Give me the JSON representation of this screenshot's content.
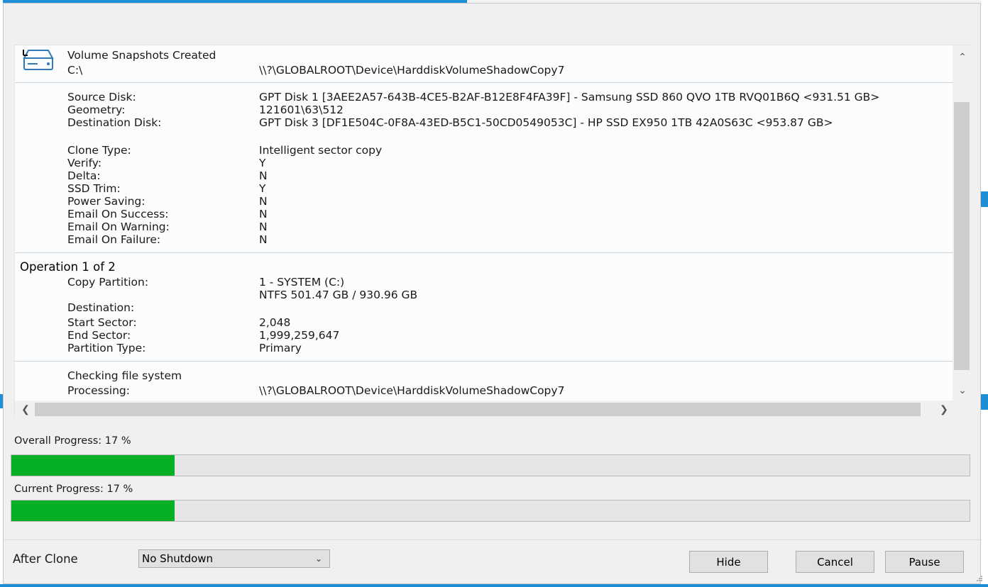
{
  "log": {
    "snapshot_heading": "Volume Snapshots Created",
    "snapshot_drive": "C:\\",
    "snapshot_path": "\\\\?\\GLOBALROOT\\Device\\HarddiskVolumeShadowCopy7",
    "disk_rows": [
      {
        "label": "Source Disk:",
        "value": "GPT Disk 1 [3AEE2A57-643B-4CE5-B2AF-B12E8F4FA39F] - Samsung SSD 860 QVO 1TB RVQ01B6Q  <931.51 GB>"
      },
      {
        "label": "Geometry:",
        "value": "121601\\63\\512"
      },
      {
        "label": "Destination Disk:",
        "value": "GPT Disk 3 [DF1E504C-0F8A-43ED-B5C1-50CD0549053C] - HP SSD EX950 1TB 42A0S63C  <953.87 GB>"
      }
    ],
    "settings_rows": [
      {
        "label": "Clone Type:",
        "value": "Intelligent sector copy"
      },
      {
        "label": "Verify:",
        "value": "Y"
      },
      {
        "label": "Delta:",
        "value": "N"
      },
      {
        "label": "SSD Trim:",
        "value": "Y"
      },
      {
        "label": "Power Saving:",
        "value": "N"
      },
      {
        "label": "Email On Success:",
        "value": "N"
      },
      {
        "label": "Email On Warning:",
        "value": "N"
      },
      {
        "label": "Email On Failure:",
        "value": "N"
      }
    ],
    "operation_heading": "Operation 1 of 2",
    "copy_partition_label": "Copy Partition:",
    "copy_partition_value": "1 - SYSTEM (C:)",
    "copy_partition_detail": "NTFS 501.47 GB / 930.96 GB",
    "destination_label": "Destination:",
    "partition_rows": [
      {
        "label": "Start Sector:",
        "value": "2,048"
      },
      {
        "label": "End Sector:",
        "value": "1,999,259,647"
      },
      {
        "label": "Partition Type:",
        "value": "Primary"
      }
    ],
    "checking_heading": "Checking file system",
    "processing_label": "Processing:",
    "processing_value": "\\\\?\\GLOBALROOT\\Device\\HarddiskVolumeShadowCopy7"
  },
  "progress": {
    "overall_label": "Overall Progress:  17 %",
    "overall_percent": 17,
    "current_label": "Current Progress:  17 %",
    "current_percent": 17
  },
  "after_clone": {
    "label": "After Clone",
    "selected": "No Shutdown"
  },
  "buttons": {
    "hide": "Hide",
    "cancel": "Cancel",
    "pause": "Pause"
  },
  "colors": {
    "progress_fill": "#06b025",
    "accent": "#1e8fd6"
  },
  "icons": {
    "disk": "hard-disk-icon"
  }
}
